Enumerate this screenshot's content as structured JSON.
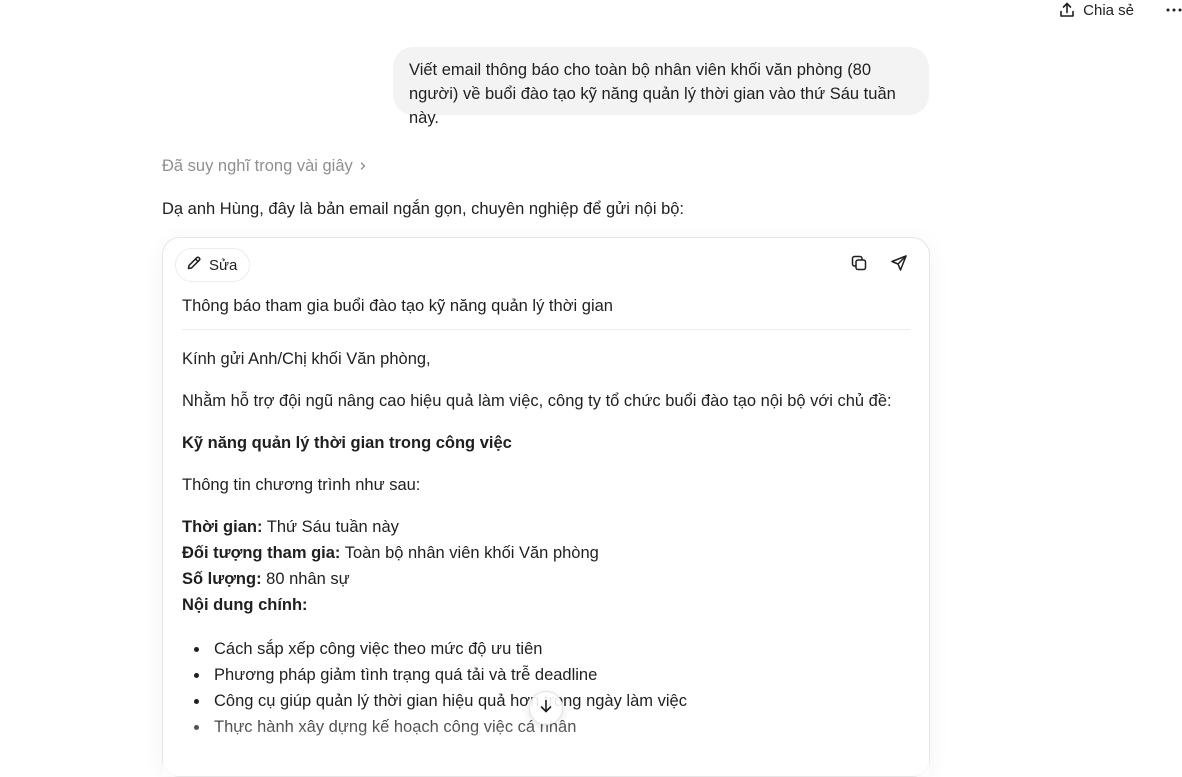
{
  "header": {
    "share_label": "Chia sẻ",
    "share_icon": "share-upload-icon",
    "more_icon": "more-horizontal-icon"
  },
  "user_message": {
    "text": "Viết email thông báo cho toàn bộ nhân viên khối văn phòng (80 người) về buổi đào tạo kỹ năng quản lý thời gian vào thứ Sáu tuần này."
  },
  "assistant": {
    "thought_label": "Đã suy nghĩ trong vài giây",
    "intro": "Dạ anh Hùng, đây là bản email ngắn gọn, chuyên nghiệp để gửi nội bộ:"
  },
  "email_card": {
    "edit_label": "Sửa",
    "edit_icon": "pencil-icon",
    "copy_icon": "copy-icon",
    "send_icon": "send-icon",
    "subject": "Thông báo tham gia buổi đào tạo kỹ năng quản lý thời gian",
    "greeting": "Kính gửi Anh/Chị khối Văn phòng,",
    "paragraph": "Nhằm hỗ trợ đội ngũ nâng cao hiệu quả làm việc, công ty tổ chức buổi đào tạo nội bộ với chủ đề:",
    "topic": "Kỹ năng quản lý thời gian trong công việc",
    "info_intro": "Thông tin chương trình như sau:",
    "details": [
      {
        "label": "Thời gian:",
        "value": " Thứ Sáu tuần này"
      },
      {
        "label": "Đối tượng tham gia:",
        "value": " Toàn bộ nhân viên khối Văn phòng"
      },
      {
        "label": "Số lượng:",
        "value": " 80 nhân sự"
      },
      {
        "label": "Nội dung chính:",
        "value": ""
      }
    ],
    "bullets": [
      "Cách sắp xếp công việc theo mức độ ưu tiên",
      "Phương pháp giảm tình trạng quá tải và trễ deadline",
      "Công cụ giúp quản lý thời gian hiệu quả hơn trong ngày làm việc",
      "Thực hành xây dựng kế hoạch công việc cá nhân"
    ]
  },
  "scroll_icon": "arrow-down-icon",
  "colors": {
    "bubble_bg": "#f3f3f3",
    "muted_text": "#8f8f8f",
    "text": "#1f1f1f",
    "border": "#e6e6e6"
  }
}
